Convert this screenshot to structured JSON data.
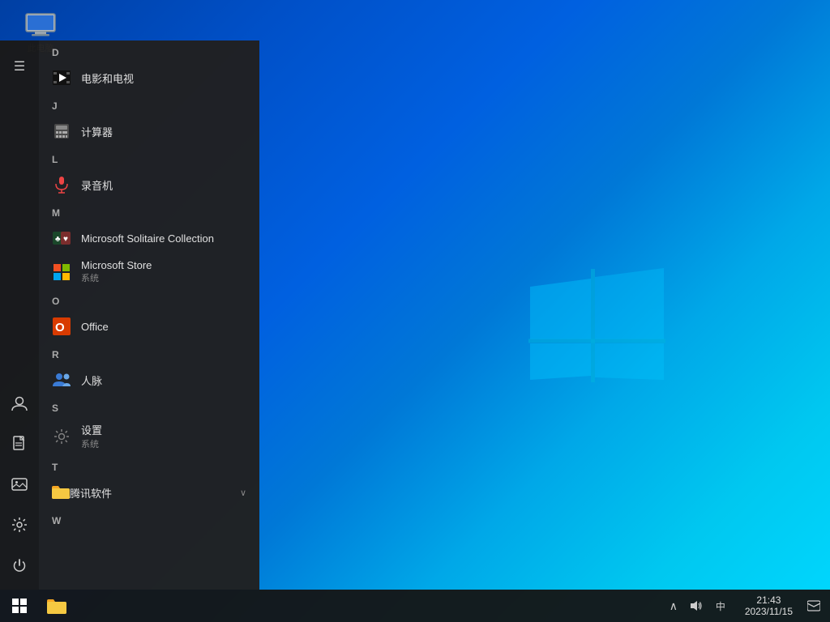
{
  "desktop": {
    "icon_label": "此电脑",
    "background": "blue-gradient"
  },
  "sidebar": {
    "hamburger": "☰",
    "items": [
      {
        "id": "user",
        "icon": "👤",
        "label": "用户"
      },
      {
        "id": "document",
        "icon": "📄",
        "label": "文档"
      },
      {
        "id": "pictures",
        "icon": "🖼",
        "label": "图片"
      },
      {
        "id": "settings",
        "icon": "⚙",
        "label": "设置"
      },
      {
        "id": "power",
        "icon": "⏻",
        "label": "电源"
      }
    ]
  },
  "app_list": {
    "sections": [
      {
        "header": "D",
        "items": [
          {
            "id": "movies",
            "icon": "film",
            "name": "电影和电视",
            "sub": ""
          }
        ]
      },
      {
        "header": "J",
        "items": [
          {
            "id": "calc",
            "icon": "calc",
            "name": "计算器",
            "sub": ""
          }
        ]
      },
      {
        "header": "L",
        "items": [
          {
            "id": "recorder",
            "icon": "mic",
            "name": "录音机",
            "sub": ""
          }
        ]
      },
      {
        "header": "M",
        "items": [
          {
            "id": "solitaire",
            "icon": "cards",
            "name": "Microsoft Solitaire Collection",
            "sub": ""
          },
          {
            "id": "store",
            "icon": "store",
            "name": "Microsoft Store",
            "sub": "系统"
          }
        ]
      },
      {
        "header": "O",
        "items": [
          {
            "id": "office",
            "icon": "office",
            "name": "Office",
            "sub": ""
          }
        ]
      },
      {
        "header": "R",
        "items": [
          {
            "id": "people",
            "icon": "people",
            "name": "人脉",
            "sub": ""
          }
        ]
      },
      {
        "header": "S",
        "items": [
          {
            "id": "settings-app",
            "icon": "gear",
            "name": "设置",
            "sub": "系统"
          }
        ]
      },
      {
        "header": "T",
        "items": [
          {
            "id": "tencent",
            "icon": "folder",
            "name": "腾讯软件",
            "sub": "",
            "expandable": true
          }
        ]
      },
      {
        "header": "W",
        "items": []
      }
    ]
  },
  "taskbar": {
    "start_icon": "⊞",
    "tray": {
      "chevron": "∧",
      "speaker": "🔊",
      "language": "中",
      "time": "21:43",
      "date": "2023/11/15",
      "notification": "🗨"
    }
  }
}
